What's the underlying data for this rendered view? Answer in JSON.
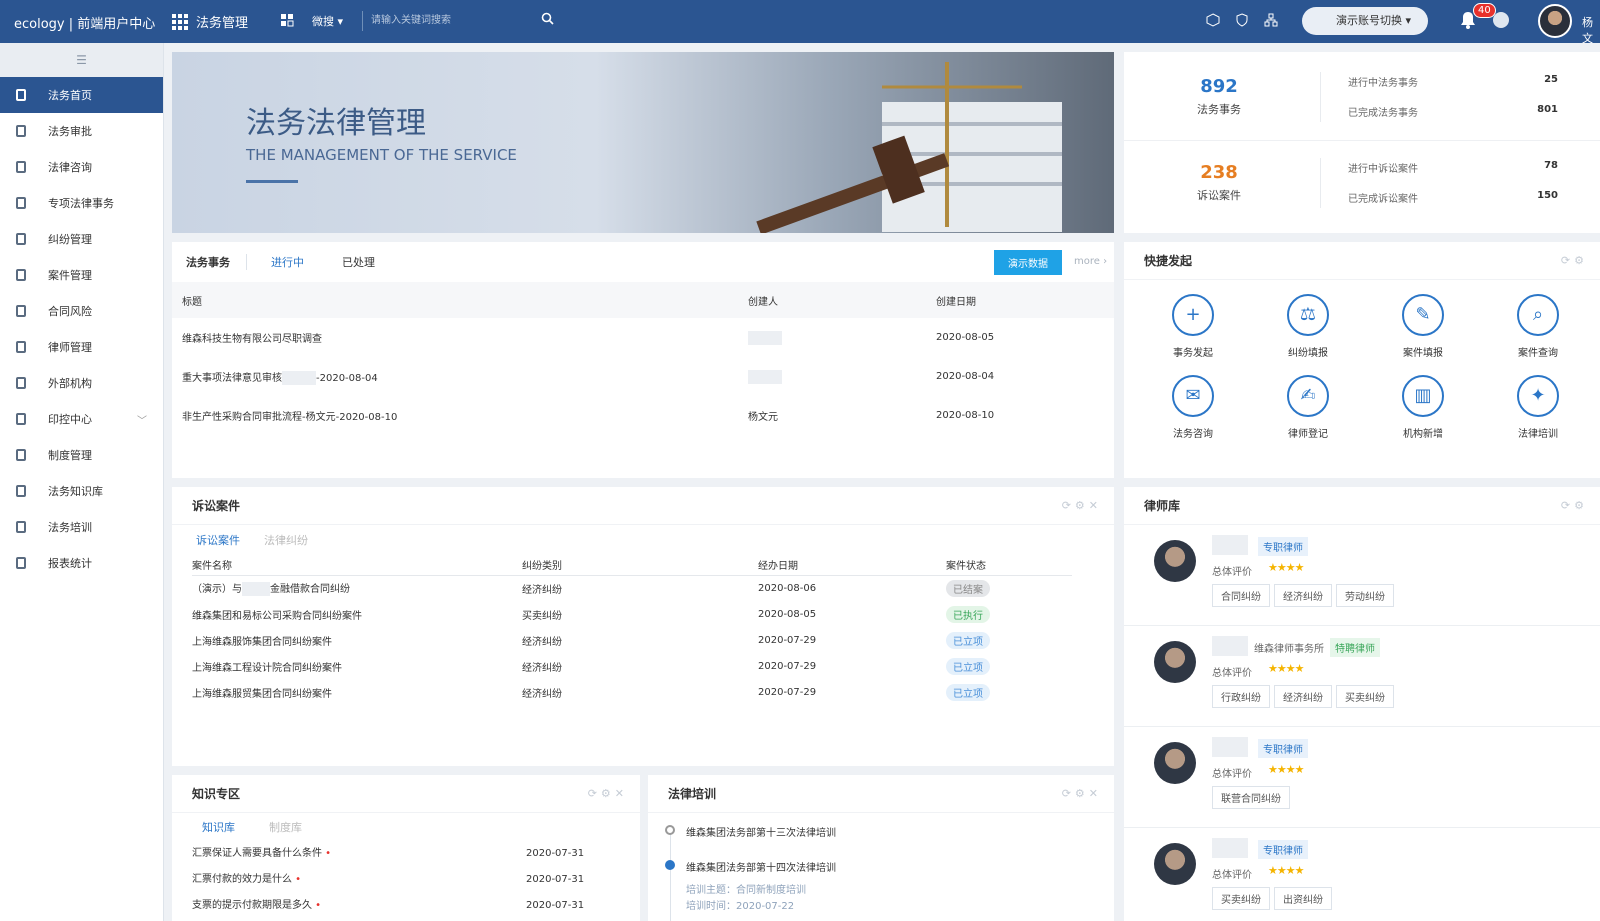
{
  "top": {
    "brand": "ecology | 前端用户中心",
    "app": "法务管理",
    "scope": "微搜",
    "search_placeholder": "请输入关键词搜索",
    "switch": "演示账号切换",
    "badge": "40",
    "user": "杨文"
  },
  "sidebar": {
    "items": [
      "法务首页",
      "法务审批",
      "法律咨询",
      "专项法律事务",
      "纠纷管理",
      "案件管理",
      "合同风险",
      "律师管理",
      "外部机构",
      "印控中心",
      "制度管理",
      "法务知识库",
      "法务培训",
      "报表统计"
    ]
  },
  "banner": {
    "title": "法务法律管理",
    "subtitle": "THE MANAGEMENT OF THE SERVICE"
  },
  "stats": {
    "affairs_num": "892",
    "affairs_label": "法务事务",
    "cases_num": "238",
    "cases_label": "诉讼案件",
    "r1l": "进行中法务事务",
    "r1v": "25",
    "r2l": "已完成法务事务",
    "r2v": "801",
    "r3l": "进行中诉讼案件",
    "r3v": "78",
    "r4l": "已完成诉讼案件",
    "r4v": "150"
  },
  "affairs": {
    "tab1": "法务事务",
    "tab2": "进行中",
    "tab3": "已处理",
    "demo": "演示数据",
    "more": "more ›",
    "h1": "标题",
    "h2": "创建人",
    "h3": "创建日期",
    "rows": [
      {
        "t": "维森科技生物有限公司尽职调查",
        "c": "",
        "d": "2020-08-05"
      },
      {
        "t": "重大事项法律意见审核",
        "t2": "-2020-08-04",
        "c": "",
        "d": "2020-08-04"
      },
      {
        "t": "非生产性采购合同审批流程-杨文元-2020-08-10",
        "c": "杨文元",
        "d": "2020-08-10"
      }
    ]
  },
  "quick": {
    "title": "快捷发起",
    "items": [
      "事务发起",
      "纠纷填报",
      "案件填报",
      "案件查询",
      "法务咨询",
      "律师登记",
      "机构新增",
      "法律培训"
    ]
  },
  "lit": {
    "title": "诉讼案件",
    "tab1": "诉讼案件",
    "tab2": "法律纠纷",
    "h1": "案件名称",
    "h2": "纠纷类别",
    "h3": "经办日期",
    "h4": "案件状态",
    "rows": [
      {
        "n": "（演示）与",
        "n2": "金融借款合同纠纷",
        "k": "经济纠纷",
        "d": "2020-08-06",
        "s": "已结案"
      },
      {
        "n": "维森集团和易标公司采购合同纠纷案件",
        "k": "买卖纠纷",
        "d": "2020-08-05",
        "s": "已执行"
      },
      {
        "n": "上海维森服饰集团合同纠纷案件",
        "k": "经济纠纷",
        "d": "2020-07-29",
        "s": "已立项"
      },
      {
        "n": "上海维森工程设计院合同纠纷案件",
        "k": "经济纠纷",
        "d": "2020-07-29",
        "s": "已立项"
      },
      {
        "n": "上海维森服贸集团合同纠纷案件",
        "k": "经济纠纷",
        "d": "2020-07-29",
        "s": "已立项"
      }
    ]
  },
  "lawyers": {
    "title": "律师库",
    "rating": "总体评价",
    "stars": "★★★★",
    "list": [
      {
        "tag": "专职律师",
        "firm": "",
        "cats": [
          "合同纠纷",
          "经济纠纷",
          "劳动纠纷"
        ]
      },
      {
        "tag": "特聘律师",
        "firm": "维森律师事务所",
        "cats": [
          "行政纠纷",
          "经济纠纷",
          "买卖纠纷"
        ]
      },
      {
        "tag": "专职律师",
        "firm": "",
        "cats": [
          "联营合同纠纷"
        ]
      },
      {
        "tag": "专职律师",
        "firm": "",
        "cats": [
          "买卖纠纷",
          "出资纠纷"
        ]
      }
    ]
  },
  "knowledge": {
    "title": "知识专区",
    "tab1": "知识库",
    "tab2": "制度库",
    "rows": [
      {
        "t": "汇票保证人需要具备什么条件",
        "d": "2020-07-31"
      },
      {
        "t": "汇票付款的效力是什么",
        "d": "2020-07-31"
      },
      {
        "t": "支票的提示付款期限是多久",
        "d": "2020-07-31"
      }
    ]
  },
  "training": {
    "title": "法律培训",
    "i1": "维森集团法务部第十三次法律培训",
    "i2": "维森集团法务部第十四次法律培训",
    "topic": "培训主题：合同新制度培训",
    "time": "培训时间：2020-07-22"
  }
}
